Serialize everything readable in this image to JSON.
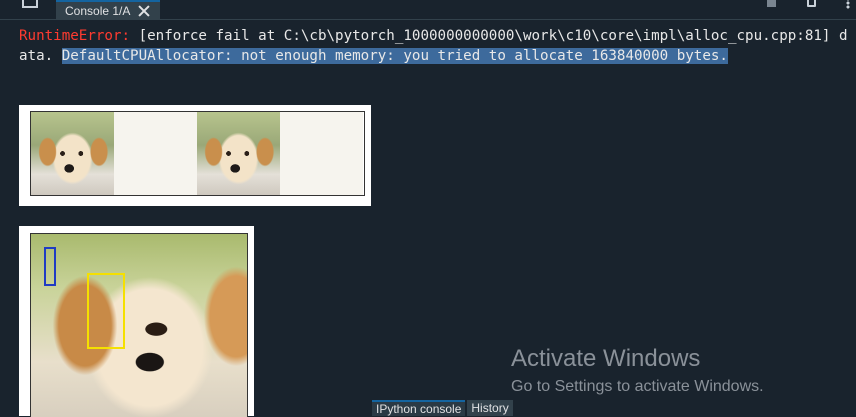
{
  "tabs": {
    "console": {
      "label": "Console 1/A"
    }
  },
  "console": {
    "error_name": "RuntimeError:",
    "error_text": " [enforce fail at C:\\cb\\pytorch_1000000000000\\work\\c10\\core\\impl\\alloc_cpu.cpp:81] data. ",
    "selected_text": "DefaultCPUAllocator: not enough memory: you tried to allocate 163840000 bytes."
  },
  "watermark": {
    "title": "Activate Windows",
    "subtitle": "Go to Settings to activate Windows."
  },
  "bottom_tabs": [
    {
      "label": "IPython console",
      "active": true
    },
    {
      "label": "History",
      "active": false
    }
  ],
  "colors": {
    "background": "#19232d",
    "error": "#ff3b30",
    "selection": "#3d6a9c",
    "box_blue": "#1f3cc4",
    "box_yellow": "#f5e000"
  }
}
